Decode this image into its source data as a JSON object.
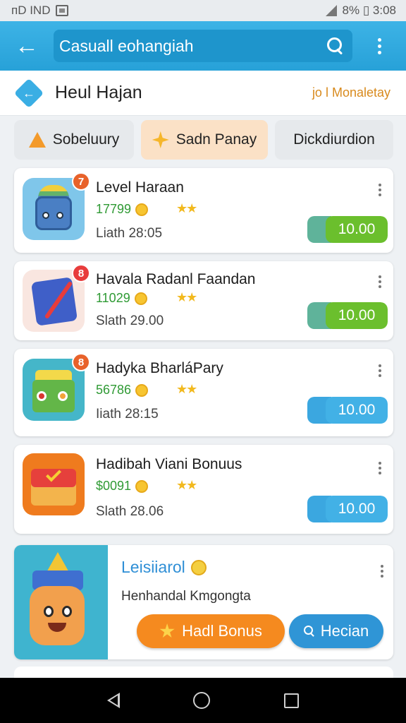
{
  "status_bar": {
    "left_text": "ᴨD IND",
    "right_text": "8% ▯ 3:08"
  },
  "app_bar": {
    "search_text": "Casuall eohangiah"
  },
  "header": {
    "icon_glyph": "←",
    "title": "Heul Hajan",
    "link": "jo l Monaletay"
  },
  "tabs": [
    {
      "label": "Sobeluury",
      "icon": "cone-icon"
    },
    {
      "label": "Sadn Panay",
      "icon": "spark-icon"
    },
    {
      "label": "Dickdiurdion",
      "icon": ""
    }
  ],
  "cards": [
    {
      "title": "Level Haraan",
      "count": "17799",
      "meta": "Liath 28:05",
      "price": "10.00",
      "badge": "7",
      "price_style": "green"
    },
    {
      "title": "Havala Radanl Faandan",
      "count": "11029",
      "meta": "Slath 29.00",
      "price": "10.00",
      "badge": "8",
      "price_style": "green"
    },
    {
      "title": "Hadyka BharláPary",
      "count": "56786",
      "meta": "Iiath 28:15",
      "price": "10.00",
      "badge": "8",
      "price_style": "blue"
    },
    {
      "title": "Hadibah Viani Bonuus",
      "count": "$0091",
      "meta": "Slath 28.06",
      "price": "10.00",
      "badge": "",
      "price_style": "blue"
    }
  ],
  "promo": {
    "title": "Leisiiarol",
    "subtitle": "Henhandal Kmgongta",
    "bonus_label": "Hadl Bonus",
    "search_label": "Hecian"
  },
  "colors": {
    "app_bar": "#27a1d8",
    "accent_orange": "#f58a1f",
    "price_green": "#6bbf2d",
    "price_blue": "#42b1e6"
  }
}
